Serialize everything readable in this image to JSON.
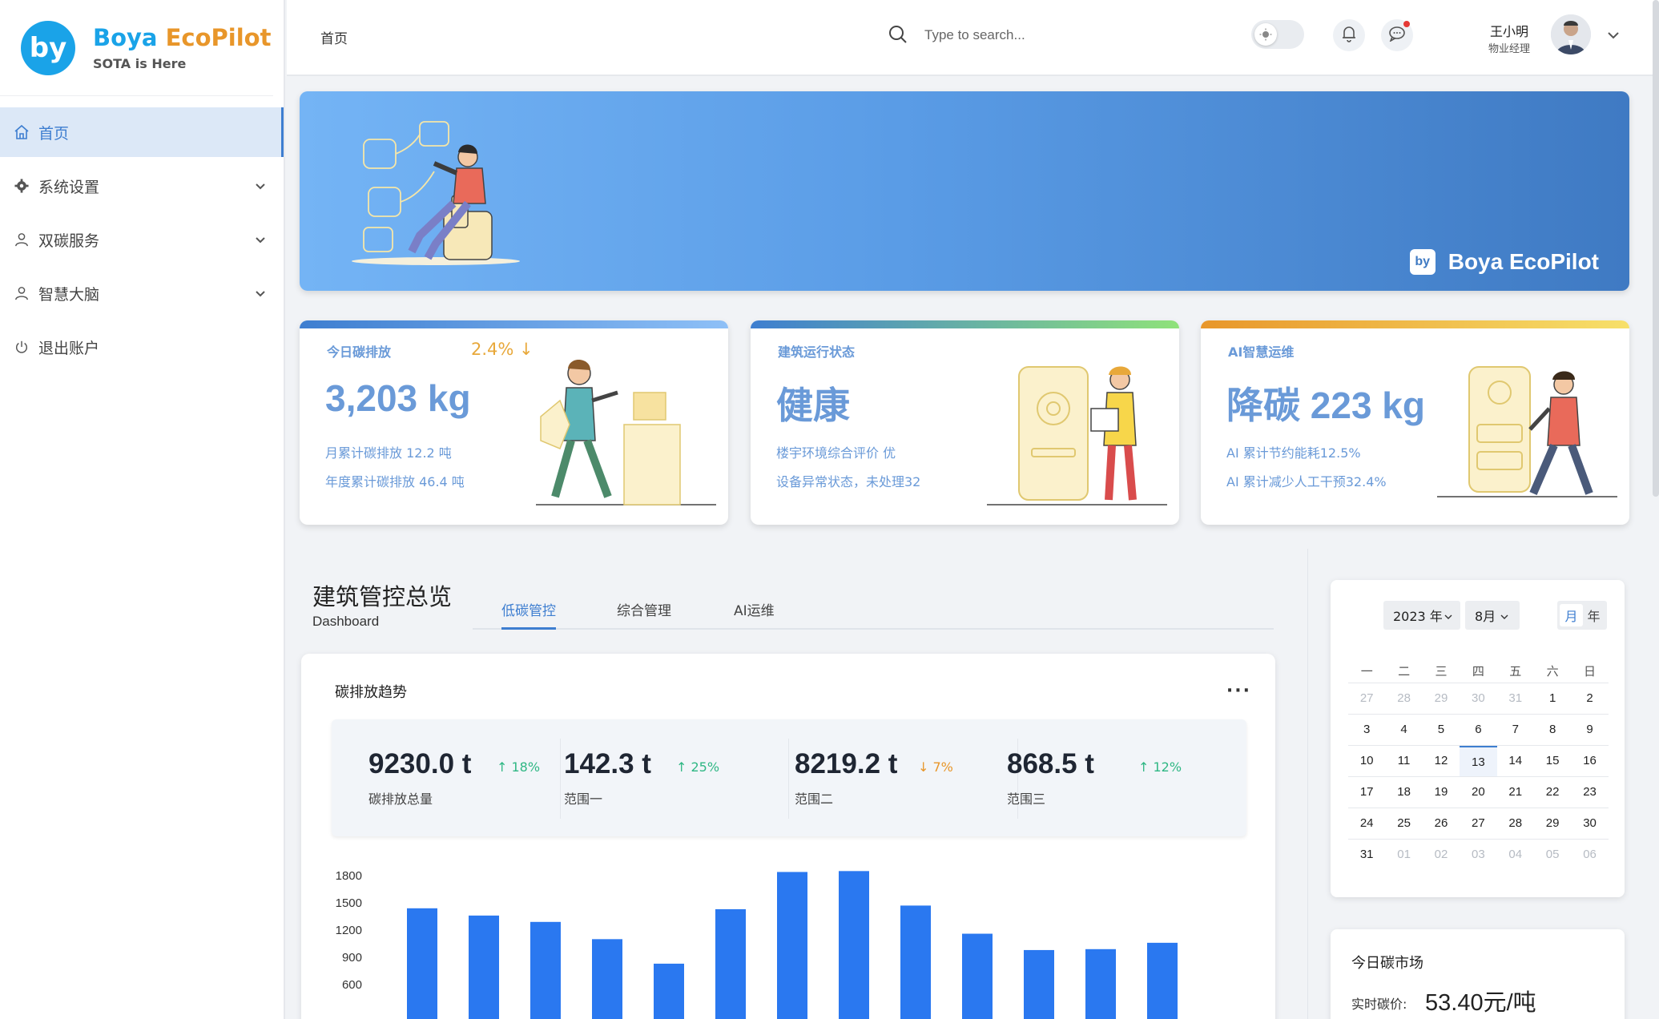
{
  "logo": {
    "mark": "by",
    "title_part1": "Boya ",
    "title_part2": "EcoPilot",
    "subtitle": "SOTA is Here"
  },
  "sidebar": {
    "items": [
      {
        "label": "首页",
        "icon": "home-icon",
        "active": true
      },
      {
        "label": "系统设置",
        "icon": "gear-icon",
        "expandable": true
      },
      {
        "label": "双碳服务",
        "icon": "user-icon",
        "expandable": true
      },
      {
        "label": "智慧大脑",
        "icon": "user-icon",
        "expandable": true
      },
      {
        "label": "退出账户",
        "icon": "power-icon"
      }
    ]
  },
  "header": {
    "breadcrumb": "首页",
    "search_placeholder": "Type to search...",
    "user_name": "王小明",
    "user_role": "物业经理"
  },
  "banner": {
    "brand": "Boya EcoPilot",
    "brand_mark": "by"
  },
  "cards": [
    {
      "label": "今日碳排放",
      "trend": "2.4% ↓",
      "value": "3,203 kg",
      "line1": "月累计碳排放 12.2 吨",
      "line2": "年度累计碳排放 46.4 吨"
    },
    {
      "label": "建筑运行状态",
      "value": "健康",
      "line1": "楼宇环境综合评价 优",
      "line2": "设备异常状态，未处理32"
    },
    {
      "label": "AI智慧运维",
      "value": "降碳 223 kg",
      "line1": "AI 累计节约能耗12.5%",
      "line2": "AI 累计减少人工干预32.4%"
    }
  ],
  "dashboard": {
    "title": "建筑管控总览",
    "subtitle": "Dashboard",
    "tabs": [
      {
        "label": "低碳管控",
        "active": true
      },
      {
        "label": "综合管理"
      },
      {
        "label": "AI运维"
      }
    ],
    "panel_title": "碳排放趋势",
    "kpis": [
      {
        "value": "9230.0 t",
        "name": "碳排放总量",
        "change": "↑ 18%",
        "dir": "up"
      },
      {
        "value": "142.3 t",
        "name": "范围一",
        "change": "↑ 25%",
        "dir": "up"
      },
      {
        "value": "8219.2 t",
        "name": "范围二",
        "change": "↓ 7%",
        "dir": "down"
      },
      {
        "value": "868.5 t",
        "name": "范围三",
        "change": "↑ 12%",
        "dir": "up"
      }
    ]
  },
  "chart_data": {
    "type": "bar",
    "yticks": [
      600,
      900,
      1200,
      1500,
      1800
    ],
    "ylim": [
      600,
      1800
    ],
    "values": [
      1440,
      1360,
      1290,
      1100,
      830,
      1430,
      1840,
      1850,
      1470,
      1160,
      980,
      990,
      1060
    ],
    "color": "#2a78f0"
  },
  "calendar": {
    "year_label": "2023 年",
    "month_label": "8月",
    "mode_month": "月",
    "mode_year": "年",
    "weekdays": [
      "一",
      "二",
      "三",
      "四",
      "五",
      "六",
      "日"
    ],
    "weeks": [
      [
        "27",
        "28",
        "29",
        "30",
        "31",
        "1",
        "2"
      ],
      [
        "3",
        "4",
        "5",
        "6",
        "7",
        "8",
        "9"
      ],
      [
        "10",
        "11",
        "12",
        "13",
        "14",
        "15",
        "16"
      ],
      [
        "17",
        "18",
        "19",
        "20",
        "21",
        "22",
        "23"
      ],
      [
        "24",
        "25",
        "26",
        "27",
        "28",
        "29",
        "30"
      ],
      [
        "31",
        "01",
        "02",
        "03",
        "04",
        "05",
        "06"
      ]
    ],
    "today": "13"
  },
  "market": {
    "title": "今日碳市场",
    "label": "实时碳价:",
    "price": "53.40元/吨"
  }
}
